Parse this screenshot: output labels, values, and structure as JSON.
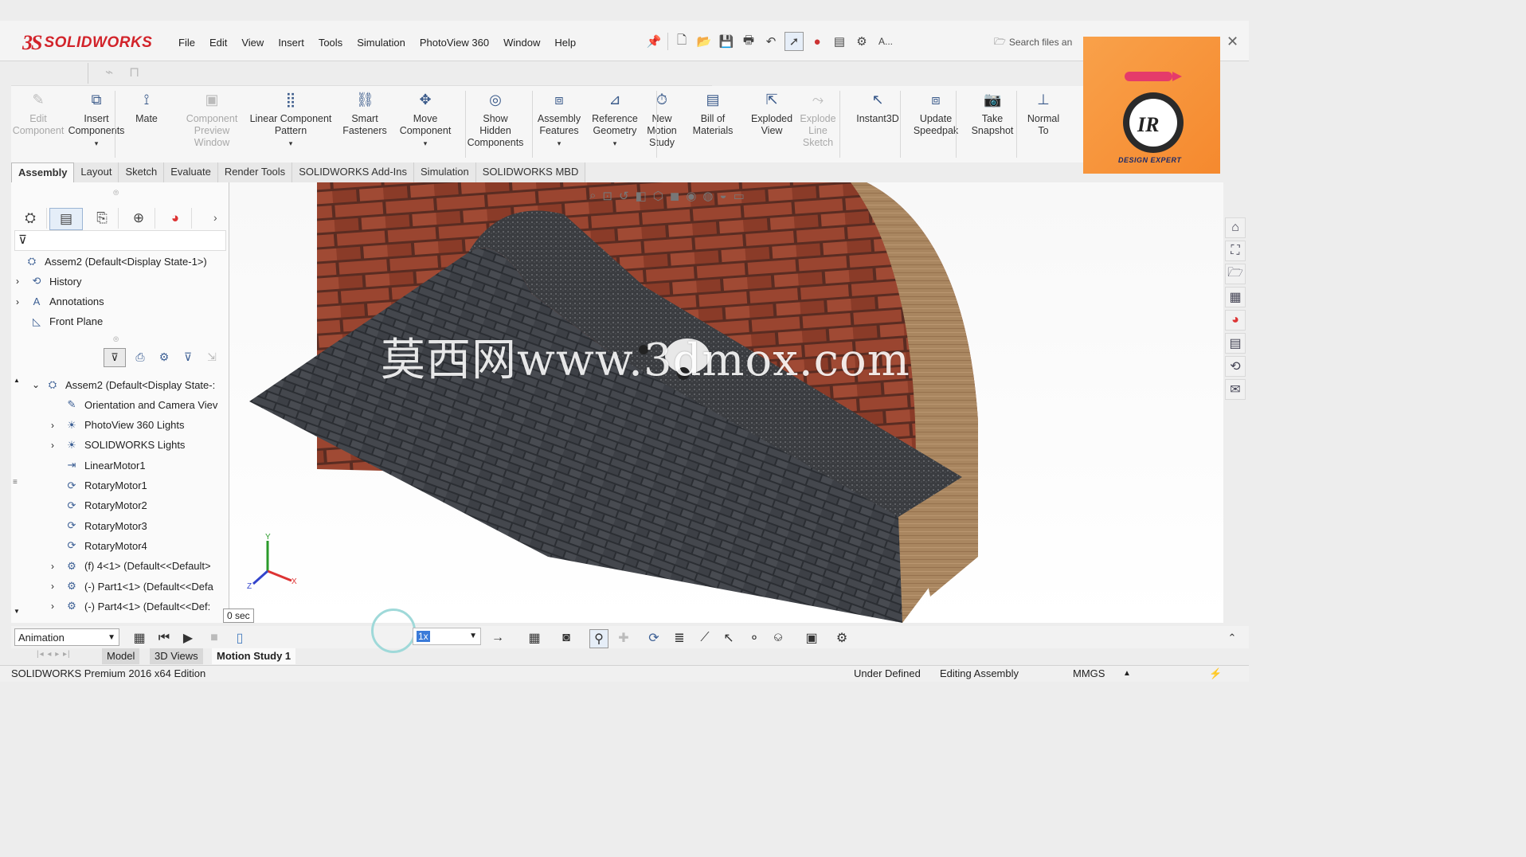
{
  "app": {
    "logo_ds": "3S",
    "logo_name": "SOLIDWORKS",
    "menus": [
      "File",
      "Edit",
      "View",
      "Insert",
      "Tools",
      "Simulation",
      "PhotoView 360",
      "Window",
      "Help"
    ],
    "search_placeholder": "Search files an",
    "extra_label": "A..."
  },
  "commands": [
    {
      "label": "Edit\nComponent",
      "disabled": true,
      "icon": "edit-component-icon"
    },
    {
      "label": "Insert\nComponents",
      "disabled": false,
      "icon": "insert-components-icon"
    },
    {
      "label": "Mate",
      "disabled": false,
      "icon": "mate-icon"
    },
    {
      "label": "Component\nPreview\nWindow",
      "disabled": true,
      "icon": "component-preview-icon"
    },
    {
      "label": "Linear Component\nPattern",
      "disabled": false,
      "icon": "linear-pattern-icon"
    },
    {
      "label": "Smart\nFasteners",
      "disabled": false,
      "icon": "smart-fasteners-icon"
    },
    {
      "label": "Move\nComponent",
      "disabled": false,
      "icon": "move-component-icon"
    },
    {
      "label": "Show\nHidden\nComponents",
      "disabled": false,
      "icon": "show-hidden-icon"
    },
    {
      "label": "Assembly\nFeatures",
      "disabled": false,
      "icon": "assembly-features-icon"
    },
    {
      "label": "Reference\nGeometry",
      "disabled": false,
      "icon": "reference-geometry-icon"
    },
    {
      "label": "New\nMotion\nStudy",
      "disabled": false,
      "icon": "new-motion-study-icon"
    },
    {
      "label": "Bill of\nMaterials",
      "disabled": false,
      "icon": "bill-of-materials-icon"
    },
    {
      "label": "Exploded\nView",
      "disabled": false,
      "icon": "exploded-view-icon"
    },
    {
      "label": "Explode\nLine\nSketch",
      "disabled": true,
      "icon": "explode-line-icon"
    },
    {
      "label": "Instant3D",
      "disabled": false,
      "icon": "instant3d-icon"
    },
    {
      "label": "Update\nSpeedpak",
      "disabled": false,
      "icon": "update-speedpak-icon"
    },
    {
      "label": "Take\nSnapshot",
      "disabled": false,
      "icon": "take-snapshot-icon"
    },
    {
      "label": "Normal\nTo",
      "disabled": false,
      "icon": "normal-to-icon"
    }
  ],
  "tabs": [
    "Assembly",
    "Layout",
    "Sketch",
    "Evaluate",
    "Render Tools",
    "SOLIDWORKS Add-Ins",
    "Simulation",
    "SOLIDWORKS MBD"
  ],
  "tree_top": [
    {
      "label": "Assem2  (Default<Display State-1>)",
      "icon": "assembly-icon",
      "expand": ""
    },
    {
      "label": "History",
      "icon": "history-icon",
      "expand": "›"
    },
    {
      "label": "Annotations",
      "icon": "annotations-icon",
      "expand": "›"
    },
    {
      "label": "Front Plane",
      "icon": "plane-icon",
      "expand": ""
    }
  ],
  "tree_motion": [
    {
      "label": "Assem2  (Default<Display State-:",
      "icon": "assembly-icon",
      "expand": "⌄"
    },
    {
      "label": "Orientation and Camera Viev",
      "icon": "camera-icon",
      "expand": ""
    },
    {
      "label": "PhotoView 360 Lights",
      "icon": "lights-icon",
      "expand": "›"
    },
    {
      "label": "SOLIDWORKS Lights",
      "icon": "lights-icon",
      "expand": "›"
    },
    {
      "label": "LinearMotor1",
      "icon": "linear-motor-icon",
      "expand": ""
    },
    {
      "label": "RotaryMotor1",
      "icon": "rotary-motor-icon",
      "expand": ""
    },
    {
      "label": "RotaryMotor2",
      "icon": "rotary-motor-icon",
      "expand": ""
    },
    {
      "label": "RotaryMotor3",
      "icon": "rotary-motor-icon",
      "expand": ""
    },
    {
      "label": "RotaryMotor4",
      "icon": "rotary-motor-icon",
      "expand": ""
    },
    {
      "label": "(f) 4<1> (Default<<Default>",
      "icon": "part-icon",
      "expand": "›"
    },
    {
      "label": "(-) Part1<1> (Default<<Defa",
      "icon": "part-icon",
      "expand": "›"
    },
    {
      "label": "(-) Part4<1> (Default<<Def:",
      "icon": "part-icon",
      "expand": "›"
    }
  ],
  "viewport": {
    "watermark": "莫西网www.3dmox.com"
  },
  "motion": {
    "study_type": "Animation",
    "time_tooltip": "0 sec",
    "speed": "1x"
  },
  "bottom_tabs": [
    "Model",
    "3D Views",
    "Motion Study 1"
  ],
  "status": {
    "edition": "SOLIDWORKS Premium 2016 x64 Edition",
    "state": "Under Defined",
    "mode": "Editing Assembly",
    "units": "MMGS"
  },
  "badge": {
    "text": "DESIGN EXPERT",
    "mono": "IR"
  },
  "colors": {
    "brand": "#d2232a",
    "badge": "#f5892e",
    "brick": "#8b3a26",
    "shingle": "#3a3d42"
  }
}
